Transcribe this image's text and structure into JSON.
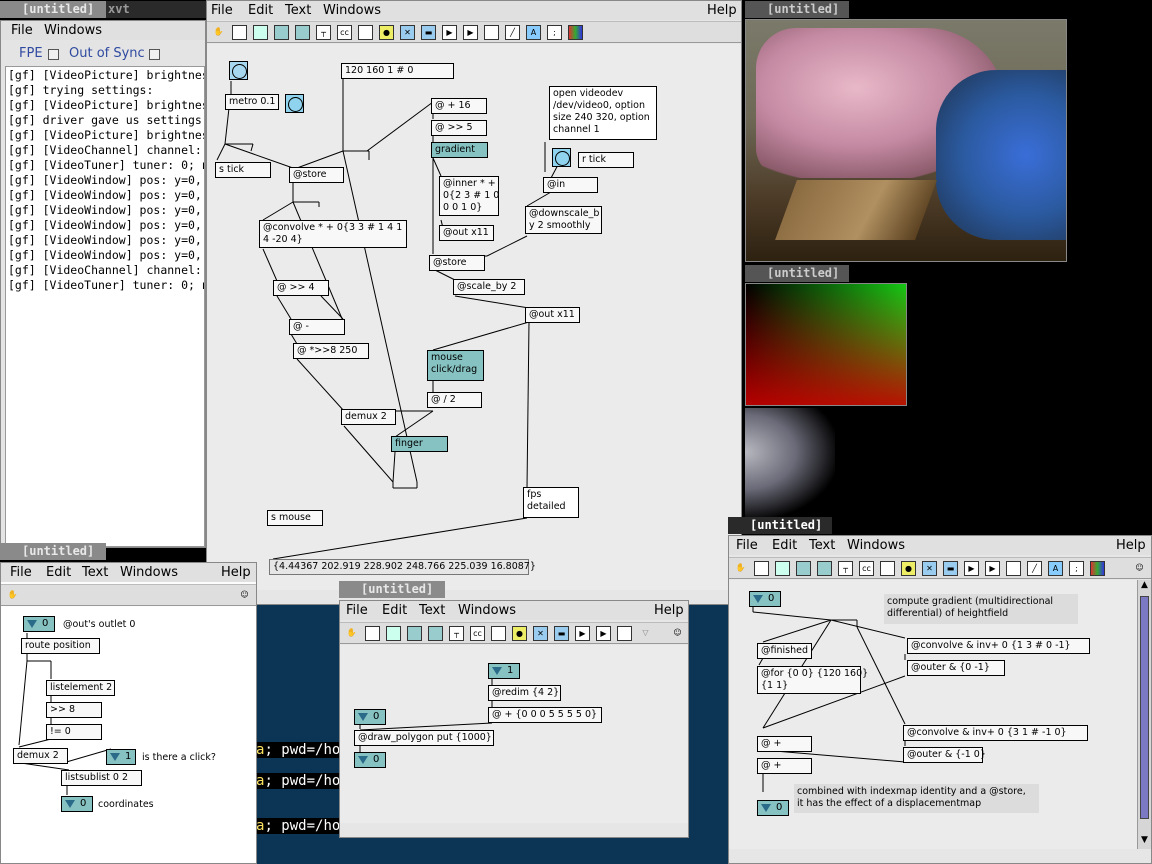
{
  "colors": {
    "gui_obj": "#86c2c2",
    "bang": "#8fd3ee",
    "desktop": "#000000",
    "terminal": "#0c3555",
    "accent_text": "#2f4aa0"
  },
  "menus": {
    "file": "File",
    "edit": "Edit",
    "text": "Text",
    "windows": "Windows",
    "help": "Help"
  },
  "console": {
    "title": "[untitled]",
    "xvt_title": "xvt",
    "fpe": "FPE",
    "out_of_sync": "Out of Sync",
    "lines": [
      "[gf] [VideoPicture] brightness: 327",
      "[gf] trying settings:",
      "[gf] [VideoPicture] brightness: 327",
      "[gf] driver gave us settings:",
      "[gf] [VideoPicture] brightness: 327",
      "[gf] [VideoChannel] channel: 0; nar",
      "[gf] [VideoTuner] tuner: 0; name: ",
      "[gf] [VideoWindow] pos: y=0, x=0",
      "[gf] [VideoWindow] pos: y=0, x=0",
      "[gf] [VideoWindow] pos: y=0, x=0",
      "[gf] [VideoWindow] pos: y=0, x=0",
      "[gf] [VideoWindow] pos: y=0, x=0",
      "[gf] [VideoWindow] pos: y=0, x=0",
      "[gf] [VideoChannel] channel: 1; nar",
      "[gf] [VideoTuner] tuner: 0; name: "
    ]
  },
  "main_patch": {
    "objects": {
      "metro": "metro 0.1",
      "msg_dims": "120 160 1 # 0",
      "plus16": "@ + 16",
      "shift5": "@ >> 5",
      "gradient": "gradient",
      "open_msg": "open videodev\n/dev/video0, option\nsize 240 320, option\nchannel 1",
      "r_tick": "r tick",
      "at_in": "@in",
      "downscale": "@downscale_b\ny 2 smoothly",
      "s_tick": "s tick",
      "store1": "@store",
      "inner": "@inner * +\n0{2 3 # 1 0\n0 0 1 0}",
      "out11a": "@out x11",
      "convolve": "@convolve * + 0{3 3 # 1 4 1\n4 -20 4}",
      "store2": "@store",
      "scale_by": "@scale_by 2",
      "out11b": "@out x11",
      "shift4": "@ >> 4",
      "minus": "@ -",
      "shift8": "@ *>>8 250",
      "mouse": "mouse\nclick/drag",
      "div2": "@ / 2",
      "demux": "demux 2",
      "finger": "finger",
      "fps": "fps\ndetailed",
      "s_mouse": "s mouse",
      "fps_out": "{4.44367 202.919 228.902 248.766 225.039 16.8087}"
    }
  },
  "video_window": {
    "title": "[untitled]"
  },
  "gradient_window": {
    "title": "[untitled]"
  },
  "left_patch": {
    "title": "[untitled]",
    "num_out": "0",
    "outlet_comment": "@out's outlet 0",
    "route": "route position",
    "listelement": "listelement 2",
    "shift8": ">> 8",
    "neq": "!= 0",
    "demux": "demux 2",
    "click_num": "1",
    "click_comment": "is there a click?",
    "sublist": "listsublist 0 2",
    "coord_num": "0",
    "coord_comment": "coordinates"
  },
  "middle_patch": {
    "title": "[untitled]",
    "num1": "1",
    "redim": "@redim {4 2}",
    "plus": "@ + {0 0 0 5 5 5 5 0}",
    "num_top": "0",
    "draw": "@draw_polygon put {1000}",
    "num_bottom": "0"
  },
  "right_patch": {
    "title": "[untitled]",
    "num0": "0",
    "comment_top": "compute gradient (multidirectional\ndifferential) of heightfield",
    "finished": "@finished",
    "for_obj": "@for {0 0} {120 160}\n{1 1}",
    "conv1": "@convolve & inv+ 0 {1 3 # 0 -1}",
    "outer1": "@outer & {0 -1}",
    "conv2": "@convolve & inv+ 0 {3 1 # -1 0}",
    "outer2": "@outer & {-1 0}",
    "plus1": "@ +",
    "plus2": "@ +",
    "comment_bottom": "combined with indexmap identity and a @store,\nit has the effect of a displacementmap",
    "num_bottom": "0"
  },
  "terminal": {
    "lines": [
      {
        "prefix": "a",
        "text": "; pwd=/ho"
      },
      {
        "prefix": "a",
        "text": "; pwd=/ho"
      },
      {
        "prefix": "a",
        "text": "; pwd=/ho"
      }
    ]
  }
}
